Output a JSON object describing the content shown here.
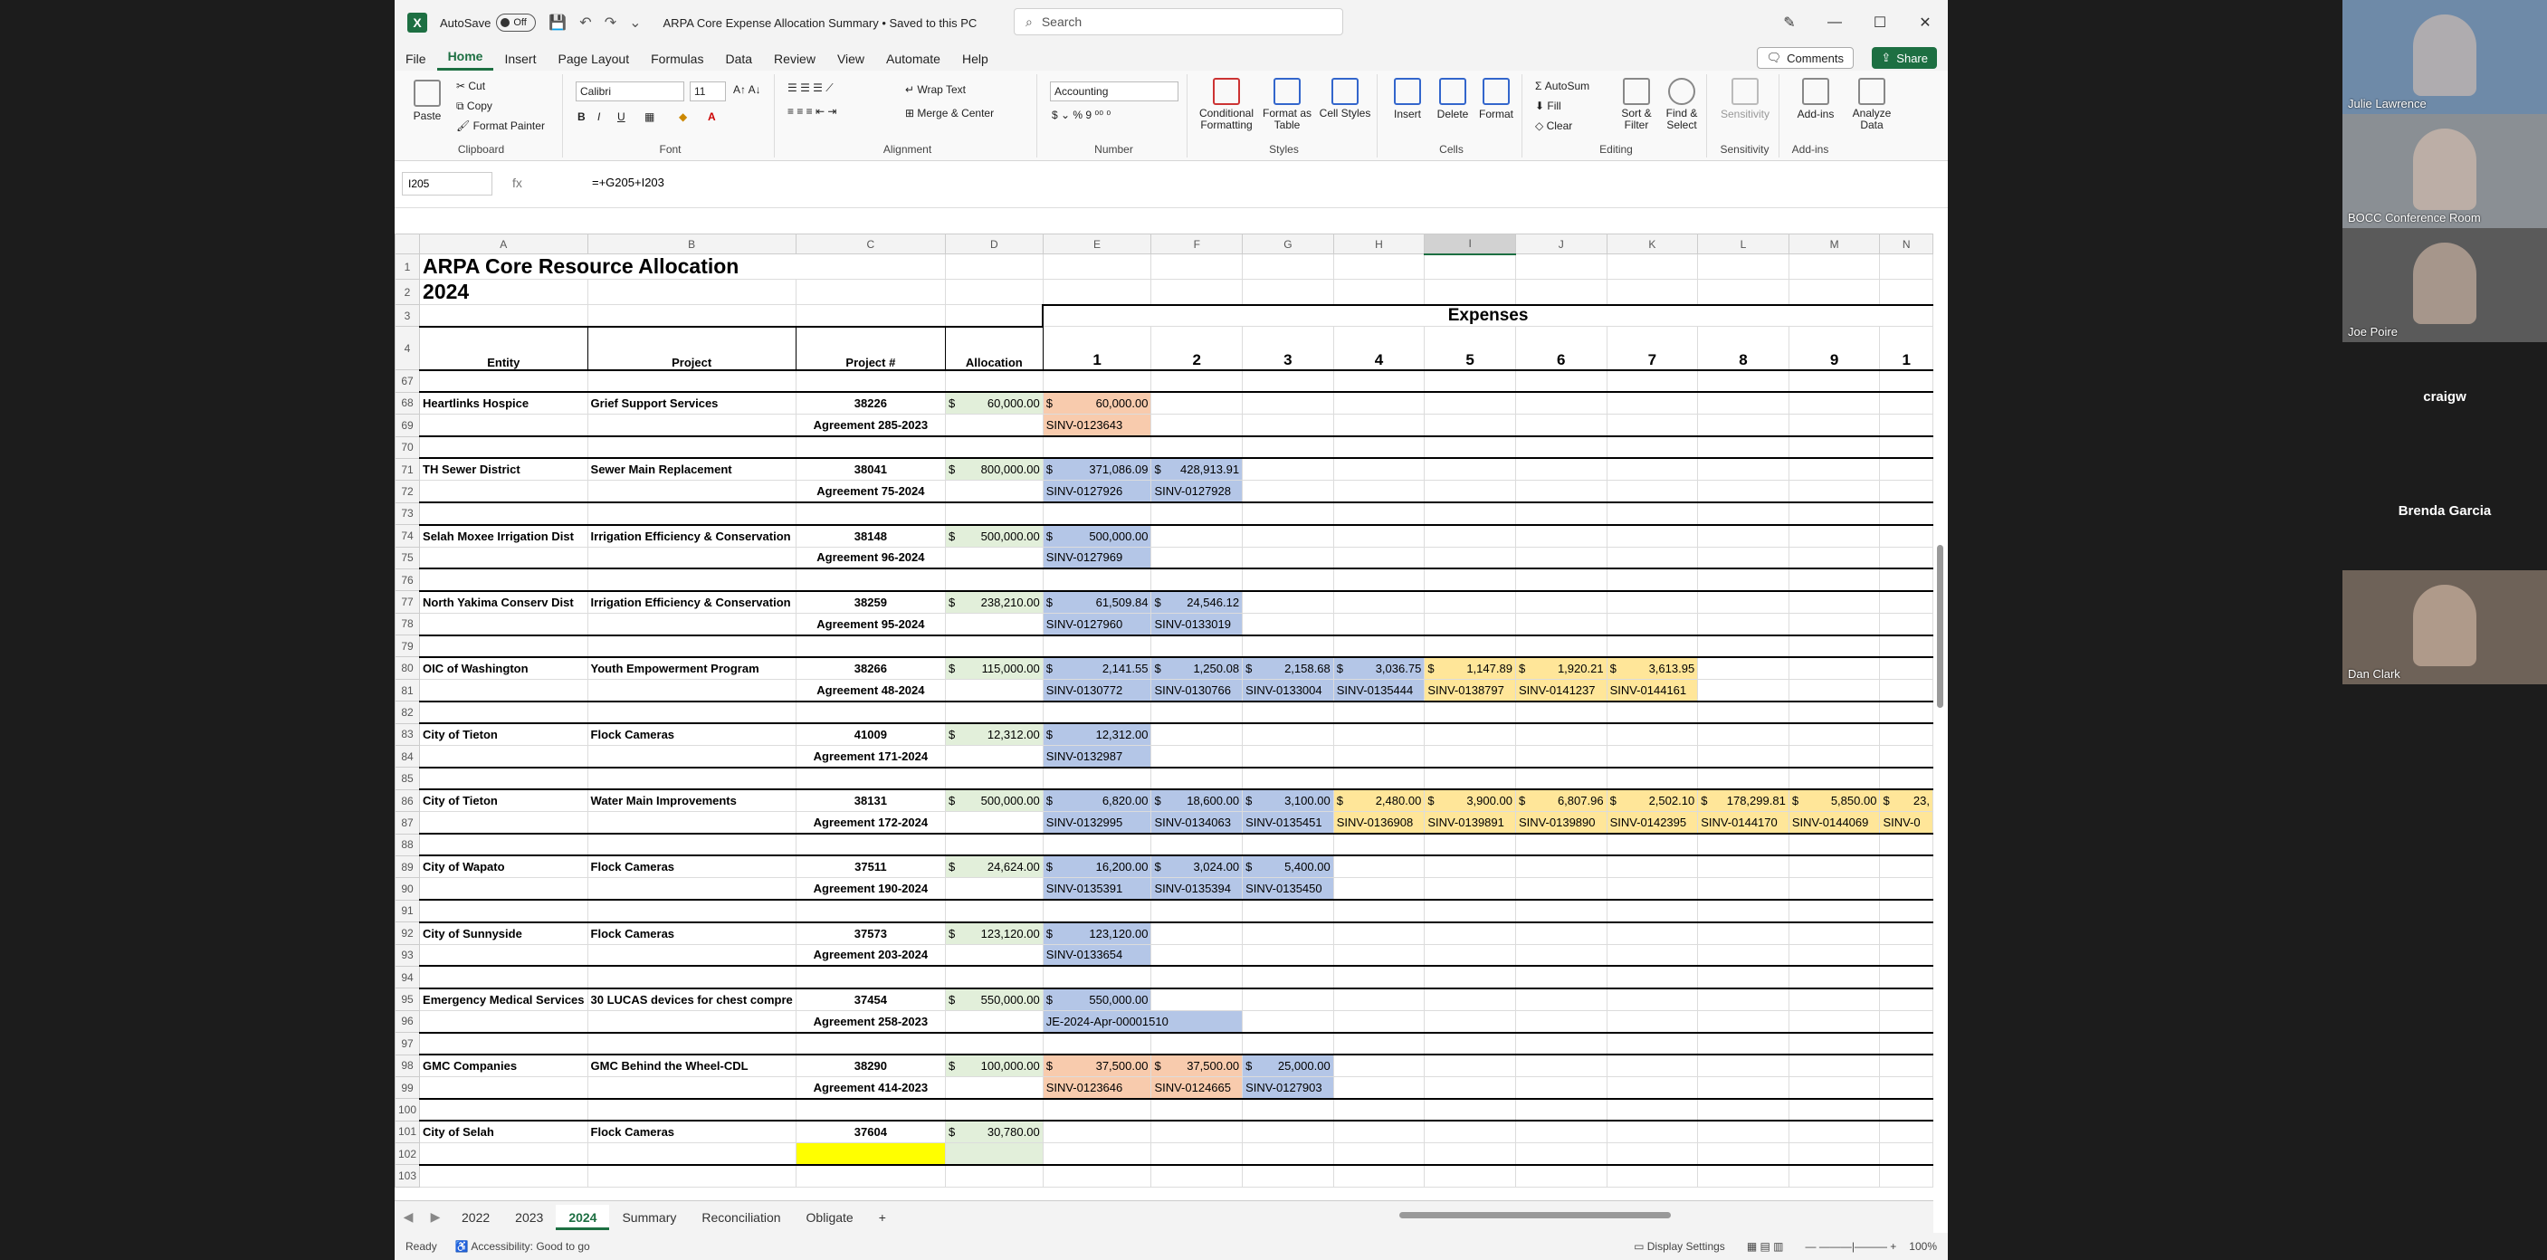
{
  "titlebar": {
    "autosave": "AutoSave",
    "autosave_state": "Off",
    "doc_title": "ARPA Core Expense Allocation Summary • Saved to this PC",
    "search": "Search"
  },
  "menu": [
    "File",
    "Home",
    "Insert",
    "Page Layout",
    "Formulas",
    "Data",
    "Review",
    "View",
    "Automate",
    "Help"
  ],
  "menu_active": "Home",
  "comments": "Comments",
  "share": "Share",
  "ribbon": {
    "clipboard": {
      "label": "Clipboard",
      "paste": "Paste",
      "cut": "Cut",
      "copy": "Copy",
      "format_painter": "Format Painter"
    },
    "font": {
      "label": "Font",
      "name": "Calibri",
      "size": "11"
    },
    "alignment": {
      "label": "Alignment",
      "wrap": "Wrap Text",
      "merge": "Merge & Center"
    },
    "number": {
      "label": "Number",
      "format": "Accounting"
    },
    "styles": {
      "label": "Styles",
      "cond": "Conditional Formatting",
      "table": "Format as Table",
      "cell": "Cell Styles"
    },
    "cells": {
      "label": "Cells",
      "insert": "Insert",
      "delete": "Delete",
      "format": "Format"
    },
    "editing": {
      "label": "Editing",
      "autosum": "AutoSum",
      "fill": "Fill",
      "clear": "Clear",
      "sort": "Sort & Filter",
      "find": "Find & Select"
    },
    "sensitivity": {
      "label": "Sensitivity",
      "btn": "Sensitivity"
    },
    "addins": {
      "label": "Add-ins",
      "btn": "Add-ins",
      "analyze": "Analyze Data"
    }
  },
  "formula": {
    "name_box": "I205",
    "fx": "fx",
    "content": "=+G205+I203"
  },
  "columns": [
    "A",
    "B",
    "C",
    "D",
    "E",
    "F",
    "G",
    "H",
    "I",
    "J",
    "K",
    "L",
    "M",
    "N"
  ],
  "header": {
    "title": "ARPA Core Resource Allocation",
    "year": "2024",
    "expenses": "Expenses",
    "entity": "Entity",
    "project": "Project",
    "project_no": "Project #",
    "allocation": "Allocation",
    "e": [
      "1",
      "2",
      "3",
      "4",
      "5",
      "6",
      "7",
      "8",
      "9",
      "1"
    ]
  },
  "sheets": [
    "2022",
    "2023",
    "2024",
    "Summary",
    "Reconciliation",
    "Obligate"
  ],
  "active_sheet": "2024",
  "status": {
    "ready": "Ready",
    "accessibility": "Accessibility: Good to go",
    "display": "Display Settings",
    "zoom": "100%"
  },
  "participants": [
    {
      "name": "Julie Lawrence",
      "type": "video",
      "bg": "#6e8aa8"
    },
    {
      "name": "BOCC Conference Room",
      "type": "video",
      "bg": "#8a8f94"
    },
    {
      "name": "Joe Poire",
      "type": "video",
      "bg": "#5a5a5a"
    },
    {
      "name": "craigw",
      "type": "name",
      "bg": "#1c1c1c"
    },
    {
      "name": "Brenda Garcia",
      "type": "name",
      "bg": "#1c1c1c"
    },
    {
      "name": "Dan Clark",
      "type": "video",
      "bg": "#6e6258"
    }
  ]
}
